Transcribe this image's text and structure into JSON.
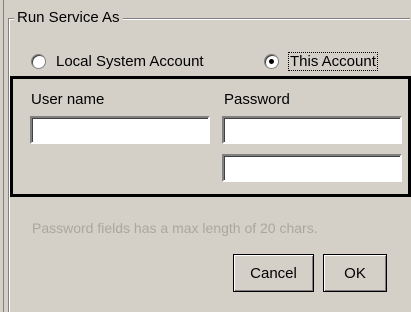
{
  "group": {
    "title": "Run Service As"
  },
  "run_as": {
    "options": [
      {
        "label": "Local System Account",
        "selected": false
      },
      {
        "label": "This Account",
        "selected": true
      }
    ]
  },
  "credentials": {
    "username_label": "User name",
    "username_value": "",
    "password_label": "Password",
    "password_value": "",
    "confirm_value": ""
  },
  "hint": "Password fields has a max length of 20 chars.",
  "buttons": {
    "cancel": "Cancel",
    "ok": "OK"
  }
}
